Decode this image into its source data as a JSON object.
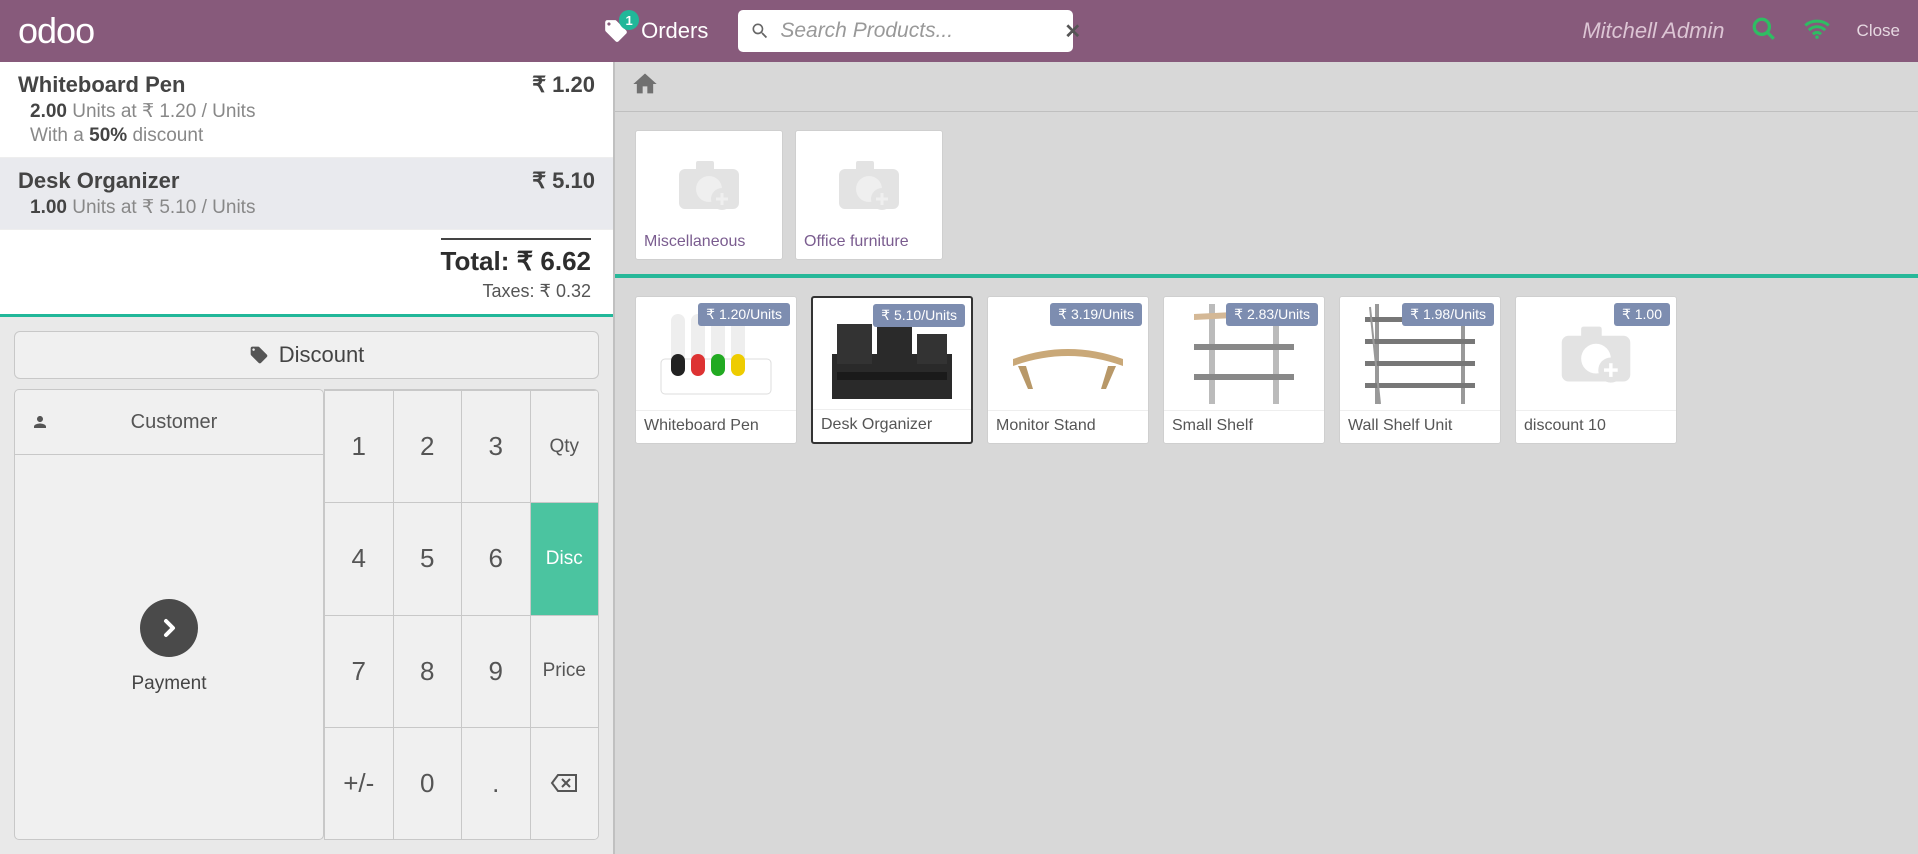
{
  "header": {
    "logo": "odoo",
    "orders_label": "Orders",
    "orders_badge": "1",
    "search_placeholder": "Search Products...",
    "user": "Mitchell Admin",
    "close": "Close"
  },
  "order": {
    "lines": [
      {
        "name": "Whiteboard Pen",
        "price": "₹ 1.20",
        "qty": "2.00",
        "unit_label": "Units at",
        "unit_price": "₹ 1.20 / Units",
        "discount_prefix": "With a",
        "discount_pct": "50%",
        "discount_suffix": "discount"
      },
      {
        "name": "Desk Organizer",
        "price": "₹ 5.10",
        "qty": "1.00",
        "unit_label": "Units at",
        "unit_price": "₹ 5.10 / Units"
      }
    ],
    "total_label": "Total:",
    "total": "₹ 6.62",
    "taxes_label": "Taxes:",
    "taxes": "₹ 0.32"
  },
  "actionpad": {
    "discount": "Discount",
    "customer": "Customer",
    "payment": "Payment"
  },
  "numpad": {
    "k1": "1",
    "k2": "2",
    "k3": "3",
    "qty": "Qty",
    "k4": "4",
    "k5": "5",
    "k6": "6",
    "disc": "Disc",
    "k7": "7",
    "k8": "8",
    "k9": "9",
    "price": "Price",
    "pm": "+/-",
    "k0": "0",
    "dot": "."
  },
  "categories": [
    {
      "label": "Miscellaneous"
    },
    {
      "label": "Office furniture"
    }
  ],
  "products": [
    {
      "name": "Whiteboard Pen",
      "price": "₹ 1.20/Units",
      "img": "pens"
    },
    {
      "name": "Desk Organizer",
      "price": "₹ 5.10/Units",
      "img": "organizer",
      "selected": true
    },
    {
      "name": "Monitor Stand",
      "price": "₹ 3.19/Units",
      "img": "stand"
    },
    {
      "name": "Small Shelf",
      "price": "₹ 2.83/Units",
      "img": "smallshelf"
    },
    {
      "name": "Wall Shelf Unit",
      "price": "₹ 1.98/Units",
      "img": "wallshelf"
    },
    {
      "name": "discount 10",
      "price": "₹ 1.00",
      "img": "placeholder"
    }
  ]
}
